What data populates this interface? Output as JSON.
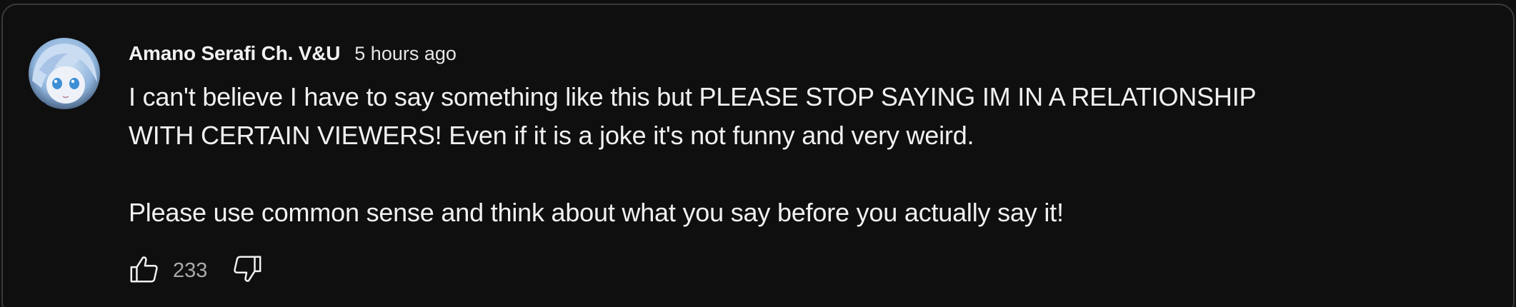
{
  "comment": {
    "author": "Amano Serafi Ch. V&U",
    "timestamp": "5 hours ago",
    "lines": [
      "I can't believe I have to say something like this but PLEASE STOP SAYING IM IN A RELATIONSHIP",
      "WITH CERTAIN VIEWERS! Even if it is a joke it's not funny and very weird.",
      "Please use common sense and think about what you say before you actually say it!"
    ],
    "like_count": "233"
  },
  "icons": {
    "avatar": "avatar-anime-character",
    "like": "thumbs-up-icon",
    "dislike": "thumbs-down-icon"
  },
  "colors": {
    "background": "#0f0f0f",
    "border": "#3a3a3a",
    "text": "#f1f1f1",
    "muted": "#aaaaaa"
  }
}
